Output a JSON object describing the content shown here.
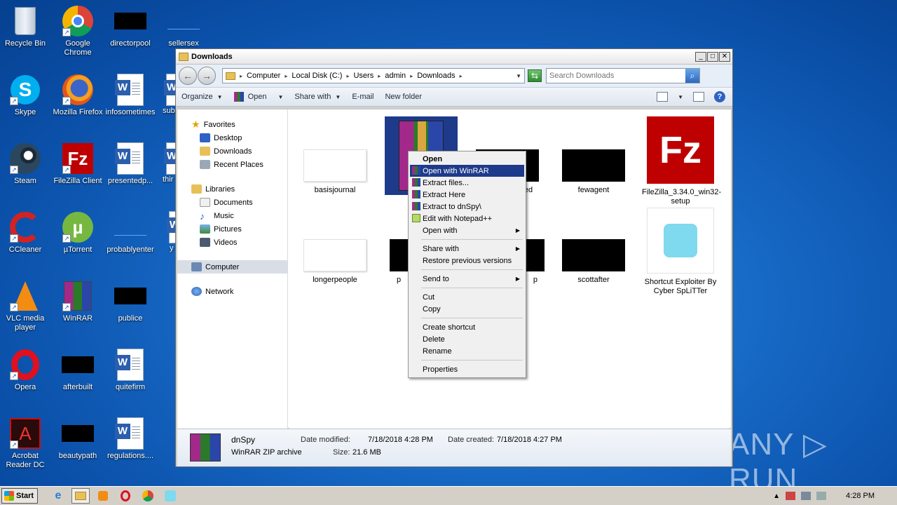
{
  "desktop": {
    "icons": [
      {
        "label": "Recycle Bin"
      },
      {
        "label": "Google Chrome"
      },
      {
        "label": "directorpool"
      },
      {
        "label": "sellersex"
      },
      {
        "label": "Skype"
      },
      {
        "label": "Mozilla Firefox"
      },
      {
        "label": "infosometimes"
      },
      {
        "label": "subr"
      },
      {
        "label": "Steam"
      },
      {
        "label": "FileZilla Client"
      },
      {
        "label": "presentedp..."
      },
      {
        "label": "thir"
      },
      {
        "label": "CCleaner"
      },
      {
        "label": "µTorrent"
      },
      {
        "label": "probablyenter"
      },
      {
        "label": "y"
      },
      {
        "label": "VLC media player"
      },
      {
        "label": "WinRAR"
      },
      {
        "label": "publice"
      },
      {
        "label": "Opera"
      },
      {
        "label": "afterbuilt"
      },
      {
        "label": "quitefirm"
      },
      {
        "label": "Acrobat Reader DC"
      },
      {
        "label": "beautypath"
      },
      {
        "label": "regulations...."
      }
    ]
  },
  "window": {
    "title": "Downloads",
    "address": {
      "crumbs": [
        "Computer",
        "Local Disk (C:)",
        "Users",
        "admin",
        "Downloads"
      ]
    },
    "search": {
      "placeholder": "Search Downloads"
    },
    "cmdbar": {
      "organize": "Organize",
      "open": "Open",
      "share_with": "Share with",
      "email": "E-mail",
      "new_folder": "New folder"
    },
    "nav": {
      "favorites": "Favorites",
      "desktop": "Desktop",
      "downloads": "Downloads",
      "recent": "Recent Places",
      "libraries": "Libraries",
      "documents": "Documents",
      "music": "Music",
      "pictures": "Pictures",
      "videos": "Videos",
      "computer": "Computer",
      "network": "Network"
    },
    "files": [
      {
        "label": "basisjournal"
      },
      {
        "label": ""
      },
      {
        "label": "ed"
      },
      {
        "label": "fewagent"
      },
      {
        "label": "FileZilla_3.34.0_win32-setup"
      },
      {
        "label": "longerpeople"
      },
      {
        "label": "p"
      },
      {
        "label": "p"
      },
      {
        "label": "scottafter"
      },
      {
        "label": "Shortcut Exploiter By Cyber SpLiTTer"
      }
    ],
    "details": {
      "name": "dnSpy",
      "type": "WinRAR ZIP archive",
      "modified_label": "Date modified:",
      "modified_value": "7/18/2018 4:28 PM",
      "created_label": "Date created:",
      "created_value": "7/18/2018 4:27 PM",
      "size_label": "Size:",
      "size_value": "21.6 MB"
    }
  },
  "context_menu": {
    "items": [
      {
        "label": "Open"
      },
      {
        "label": "Open with WinRAR"
      },
      {
        "label": "Extract files..."
      },
      {
        "label": "Extract Here"
      },
      {
        "label": "Extract to dnSpy\\"
      },
      {
        "label": "Edit with Notepad++"
      },
      {
        "label": "Open with"
      },
      {
        "label": "Share with"
      },
      {
        "label": "Restore previous versions"
      },
      {
        "label": "Send to"
      },
      {
        "label": "Cut"
      },
      {
        "label": "Copy"
      },
      {
        "label": "Create shortcut"
      },
      {
        "label": "Delete"
      },
      {
        "label": "Rename"
      },
      {
        "label": "Properties"
      }
    ]
  },
  "taskbar": {
    "start": "Start",
    "clock": "4:28 PM"
  },
  "watermark": "ANY ▷ RUN"
}
